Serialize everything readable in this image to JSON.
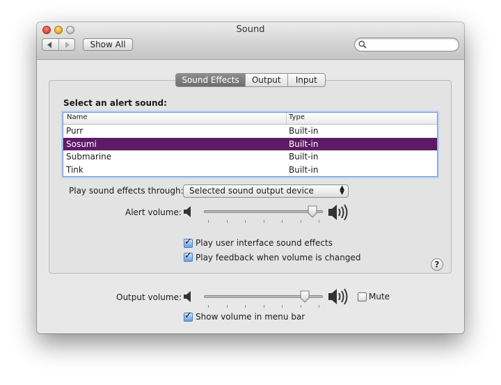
{
  "window": {
    "title": "Sound"
  },
  "toolbar": {
    "back_icon": "back-arrow-icon",
    "forward_icon": "forward-arrow-icon",
    "show_all_label": "Show All",
    "search_placeholder": ""
  },
  "tabs": [
    {
      "label": "Sound Effects",
      "selected": true
    },
    {
      "label": "Output",
      "selected": false
    },
    {
      "label": "Input",
      "selected": false
    }
  ],
  "sound_effects": {
    "section_label": "Select an alert sound:",
    "table": {
      "columns": [
        "Name",
        "Type"
      ],
      "rows": [
        {
          "name": "Purr",
          "type": "Built-in",
          "selected": false
        },
        {
          "name": "Sosumi",
          "type": "Built-in",
          "selected": true
        },
        {
          "name": "Submarine",
          "type": "Built-in",
          "selected": false
        },
        {
          "name": "Tink",
          "type": "Built-in",
          "selected": false
        }
      ]
    },
    "play_through_label": "Play sound effects through:",
    "play_through_value": "Selected sound output device",
    "alert_volume_label": "Alert volume:",
    "alert_volume_level": 0.95,
    "checkbox_ui_sounds": {
      "label": "Play user interface sound effects",
      "checked": true
    },
    "checkbox_feedback": {
      "label": "Play feedback when volume is changed",
      "checked": true
    },
    "help_label": "?"
  },
  "output_volume": {
    "label": "Output volume:",
    "level": 0.88,
    "mute": {
      "label": "Mute",
      "checked": false
    },
    "show_in_menu_bar": {
      "label": "Show volume in menu bar",
      "checked": true
    }
  },
  "colors": {
    "selection": "#5e1b65",
    "active_tab": "#7e7e7e",
    "checkbox_checked": "#6aa0e2"
  }
}
